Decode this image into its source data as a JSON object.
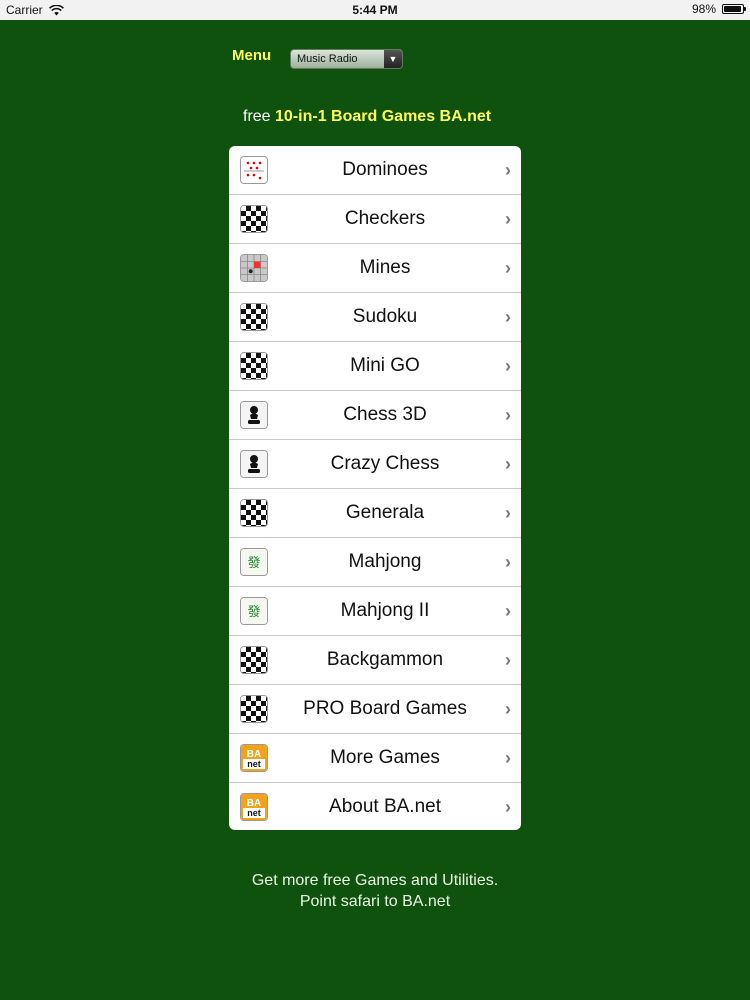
{
  "status_bar": {
    "carrier": "Carrier",
    "time": "5:44 PM",
    "battery": "98%"
  },
  "menu": {
    "label": "Menu",
    "dropdown_value": "Music Radio"
  },
  "heading": {
    "prefix": "free",
    "brand": "10-in-1 Board Games BA.net"
  },
  "games": [
    {
      "label": "Dominoes",
      "icon": "dominoes-icon"
    },
    {
      "label": "Checkers",
      "icon": "checkerboard-icon"
    },
    {
      "label": "Mines",
      "icon": "mines-icon"
    },
    {
      "label": "Sudoku",
      "icon": "checkerboard-icon"
    },
    {
      "label": "Mini GO",
      "icon": "checkerboard-icon"
    },
    {
      "label": "Chess 3D",
      "icon": "pawn-icon"
    },
    {
      "label": "Crazy Chess",
      "icon": "pawn-icon"
    },
    {
      "label": "Generala",
      "icon": "checkerboard-icon"
    },
    {
      "label": "Mahjong",
      "icon": "mahjong-tile-icon"
    },
    {
      "label": "Mahjong II",
      "icon": "mahjong-tile-icon"
    },
    {
      "label": "Backgammon",
      "icon": "checkerboard-icon"
    },
    {
      "label": "PRO Board Games",
      "icon": "checkerboard-icon"
    },
    {
      "label": "More Games",
      "icon": "ba-net-logo-icon"
    },
    {
      "label": "About BA.net",
      "icon": "ba-net-logo-icon"
    }
  ],
  "footer": {
    "line1": "Get more free Games and Utilities.",
    "line2": "Point safari to BA.net"
  },
  "colors": {
    "background": "#0f520e",
    "accent": "#fffb57"
  }
}
